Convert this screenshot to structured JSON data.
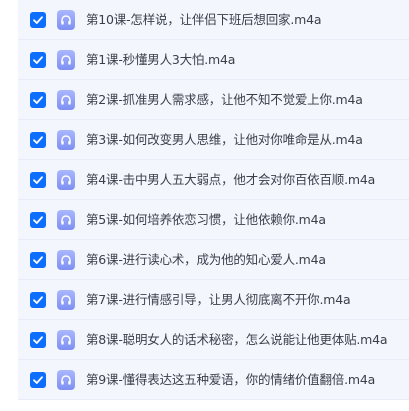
{
  "colors": {
    "accent": "#0d6efd",
    "row_background": "#f3f6fd",
    "icon_background": "#8b99f6",
    "text": "#3a3f4a"
  },
  "icons": {
    "checkbox": "checkmark-icon",
    "file": "headphones-icon"
  },
  "files": [
    {
      "name": "第10课-怎样说，让伴侣下班后想回家.m4a",
      "checked": true
    },
    {
      "name": "第1课-秒懂男人3大怕.m4a",
      "checked": true
    },
    {
      "name": "第2课-抓准男人需求感，让他不知不觉爱上你.m4a",
      "checked": true
    },
    {
      "name": "第3课-如何改变男人思维，让他对你唯命是从.m4a",
      "checked": true
    },
    {
      "name": "第4课-击中男人五大弱点，他才会对你百依百顺.m4a",
      "checked": true
    },
    {
      "name": "第5课-如何培养依恋习惯，让他依赖你.m4a",
      "checked": true
    },
    {
      "name": "第6课-进行读心术，成为他的知心爱人.m4a",
      "checked": true
    },
    {
      "name": "第7课-进行情感引导，让男人彻底离不开你.m4a",
      "checked": true
    },
    {
      "name": "第8课-聪明女人的话术秘密，怎么说能让他更体贴.m4a",
      "checked": true
    },
    {
      "name": "第9课-懂得表达这五种爱语，你的情绪价值翻倍.m4a",
      "checked": true
    }
  ]
}
